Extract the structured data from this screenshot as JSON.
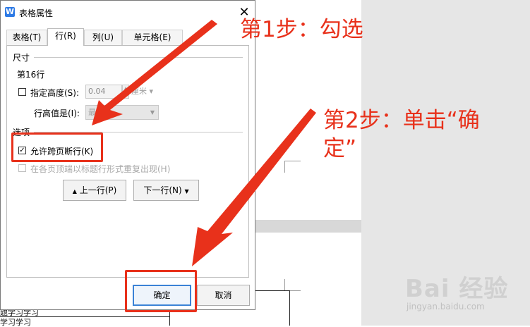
{
  "dialog": {
    "title": "表格属性",
    "app_icon_glyph": "W",
    "close_glyph": "✕",
    "tabs": [
      {
        "label": "表格(T)"
      },
      {
        "label": "行(R)"
      },
      {
        "label": "列(U)"
      },
      {
        "label": "单元格(E)"
      }
    ],
    "active_tab": 1,
    "size_section": {
      "label": "尺寸",
      "row_number": "第16行",
      "specify_height": {
        "label": "指定高度(S):",
        "checked": false,
        "value": "0.04",
        "unit": "厘米"
      },
      "height_mode": {
        "label": "行高值是(I):",
        "value": "最"
      }
    },
    "options_section": {
      "label": "选项",
      "allow_break": {
        "label": "允许跨页断行(K)",
        "checked": true
      },
      "repeat_header": {
        "label": "在各页顶端以标题行形式重复出现(H)",
        "checked": false
      }
    },
    "nav_buttons": {
      "prev": "上一行(P)",
      "next": "下一行(N)"
    },
    "footer": {
      "ok": "确定",
      "cancel": "取消"
    }
  },
  "annotations": {
    "step1": "第1步：勾选",
    "step2_line1": "第2步：单击“确",
    "step2_line2": "定”",
    "color": "#e8311b"
  },
  "background": {
    "doc_text_1": "题学习学习",
    "doc_text_2": "学习学习"
  },
  "watermark": {
    "brand": "Bai 经验",
    "url": "jingyan.baidu.com"
  }
}
